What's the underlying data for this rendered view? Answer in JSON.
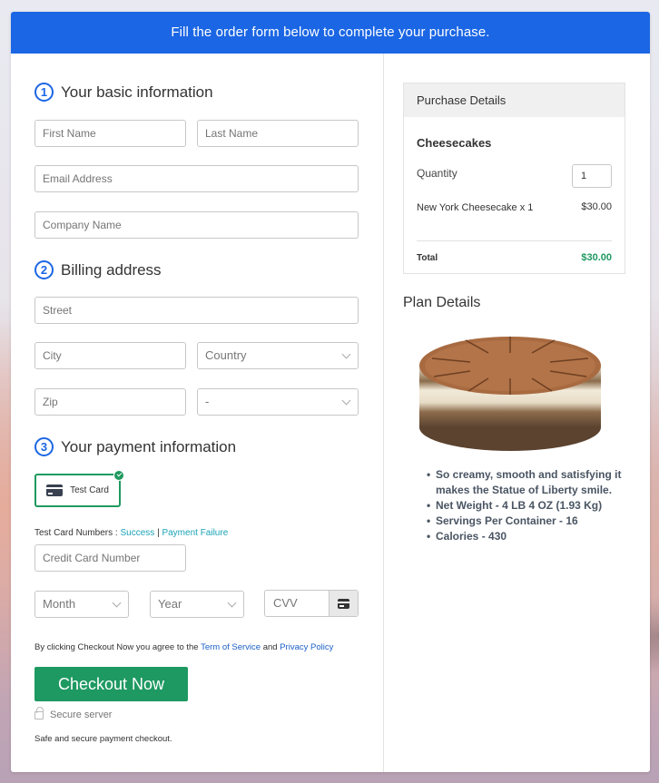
{
  "banner": {
    "text": "Fill the order form below to complete your purchase."
  },
  "basic": {
    "number": "1",
    "title": "Your basic information",
    "first_name_placeholder": "First Name",
    "last_name_placeholder": "Last Name",
    "email_placeholder": "Email Address",
    "company_placeholder": "Company Name"
  },
  "billing": {
    "number": "2",
    "title": "Billing address",
    "street_placeholder": "Street",
    "city_placeholder": "City",
    "country_selected": "Country",
    "zip_placeholder": "Zip",
    "state_selected": "-"
  },
  "payment": {
    "number": "3",
    "title": "Your payment information",
    "method_label": "Test Card",
    "test_numbers_label": "Test Card Numbers : ",
    "success_link": "Success",
    "separator": "|",
    "failure_link": "Payment Failure",
    "card_number_placeholder": "Credit Card Number",
    "month_selected": "Month",
    "year_selected": "Year",
    "cvv_placeholder": "CVV",
    "agree_prefix": "By clicking Checkout Now you agree to the ",
    "terms_link": "Term of Service",
    "agree_and": " and ",
    "privacy_link": "Privacy Policy",
    "checkout_label": "Checkout Now",
    "secure_label": "Secure server",
    "safe_text": "Safe and secure payment checkout."
  },
  "purchase": {
    "title": "Purchase Details",
    "product_group": "Cheesecakes",
    "quantity_label": "Quantity",
    "quantity_value": "1",
    "item_label": "New York Cheesecake x 1",
    "item_price": "$30.00",
    "total_label": "Total",
    "total_value": "$30.00"
  },
  "plan": {
    "title": "Plan Details",
    "bullets": [
      "So creamy, smooth and satisfying it makes the Statue of Liberty smile.",
      "Net Weight - 4 LB 4 OZ (1.93 Kg)",
      "Servings Per Container - 16",
      "Calories - 430"
    ]
  },
  "colors": {
    "brand_blue": "#1b66e4",
    "success_green": "#1e9962",
    "link_teal": "#1aa3b6",
    "link_blue": "#1b5fc7"
  }
}
